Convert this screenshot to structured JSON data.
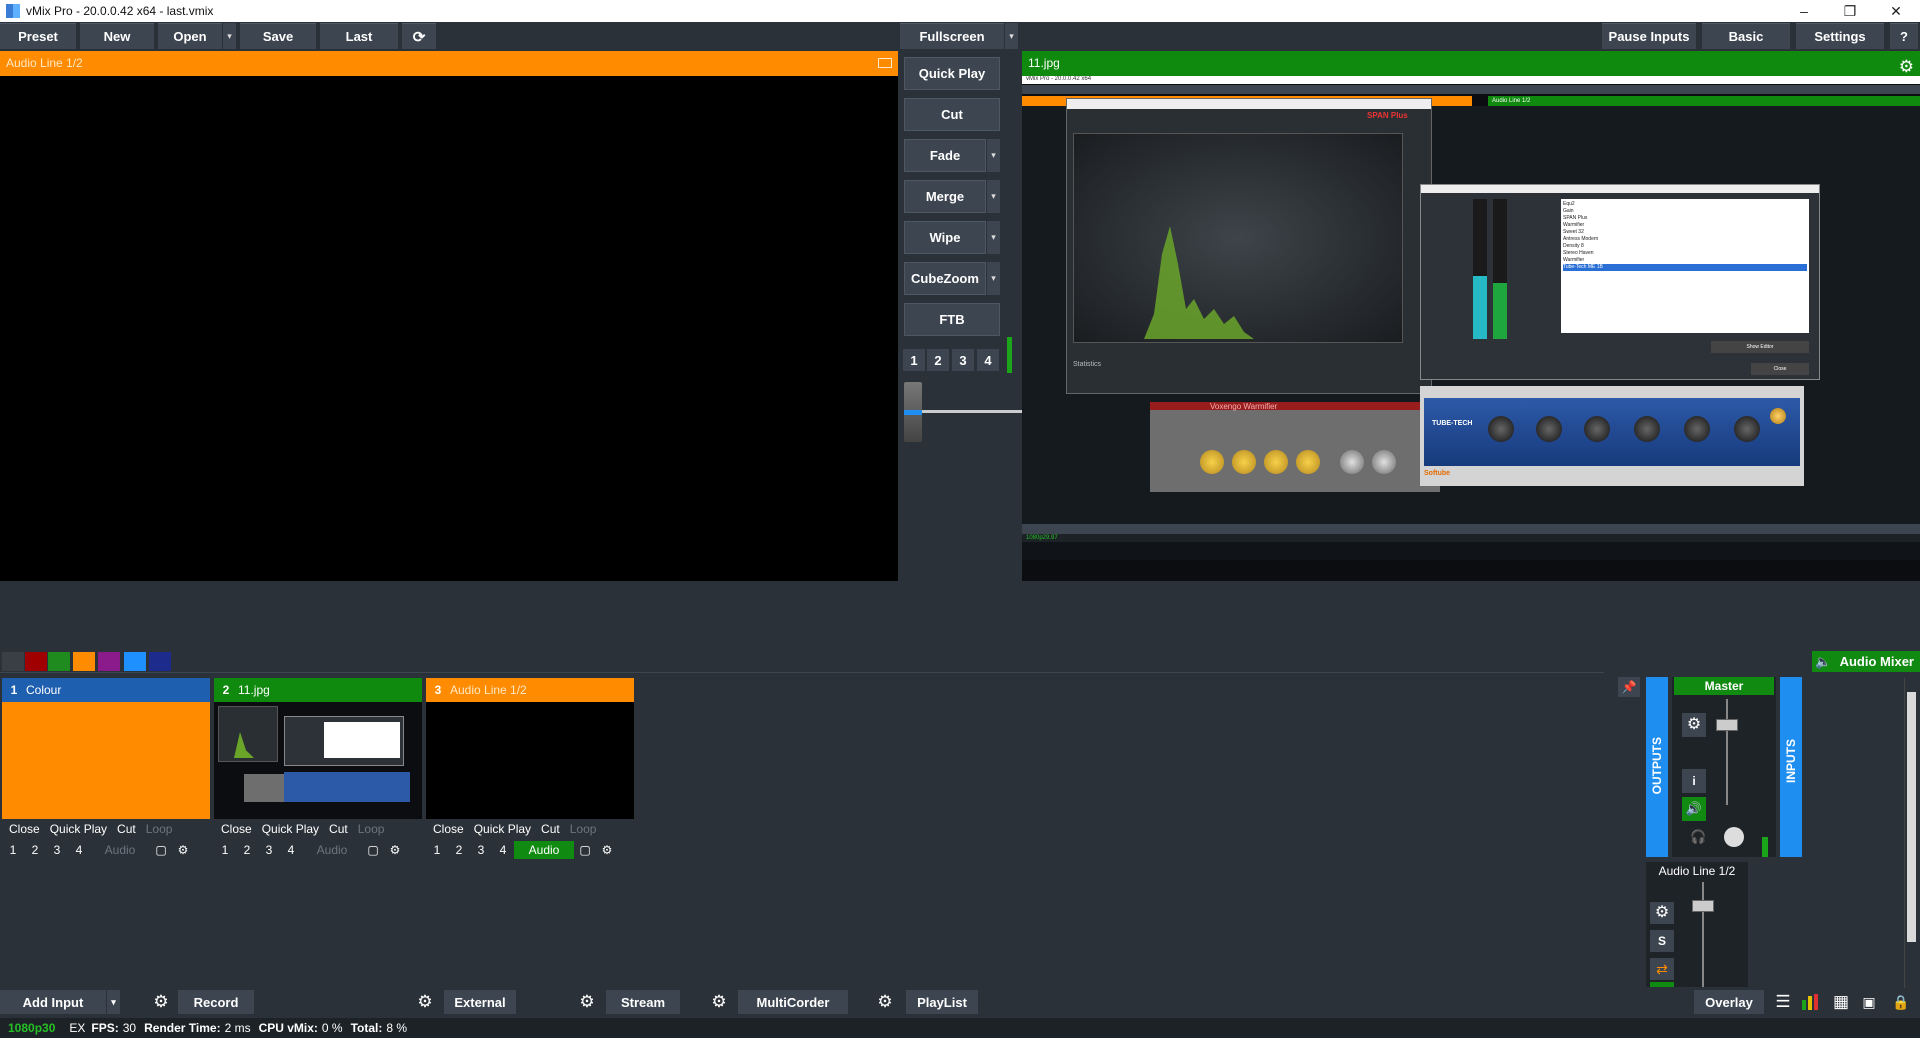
{
  "window": {
    "title": "vMix Pro - 20.0.0.42 x64 - last.vmix"
  },
  "toolbar": {
    "preset": "Preset",
    "new": "New",
    "open": "Open",
    "save": "Save",
    "last": "Last",
    "fullscreen": "Fullscreen",
    "pause_inputs": "Pause Inputs",
    "basic": "Basic",
    "settings": "Settings",
    "help": "?"
  },
  "preview": {
    "title": "Audio Line 1/2"
  },
  "output": {
    "title": "11.jpg"
  },
  "transitions": {
    "quick_play": "Quick Play",
    "cut": "Cut",
    "fade": "Fade",
    "merge": "Merge",
    "wipe": "Wipe",
    "cubezoom": "CubeZoom",
    "ftb": "FTB",
    "numbers": [
      "1",
      "2",
      "3",
      "4"
    ]
  },
  "colors": {
    "preview": "#ff8c00",
    "program": "#108a10",
    "accent": "#1f8ef1",
    "swatches": [
      "#3a3f46",
      "#a00000",
      "#1f8b1f",
      "#ff8c00",
      "#8b1a8b",
      "#1e90ff",
      "#1c2b8c"
    ]
  },
  "inputs": [
    {
      "num": "1",
      "name": "Colour",
      "head_color": "#1e5fb0",
      "controls": [
        "Close",
        "Quick Play",
        "Cut",
        "Loop"
      ],
      "audio": "Audio",
      "audio_on": false,
      "numbers": [
        "1",
        "2",
        "3",
        "4"
      ]
    },
    {
      "num": "2",
      "name": "11.jpg",
      "head_color": "#0f8a0f",
      "controls": [
        "Close",
        "Quick Play",
        "Cut",
        "Loop"
      ],
      "audio": "Audio",
      "audio_on": false,
      "numbers": [
        "1",
        "2",
        "3",
        "4"
      ]
    },
    {
      "num": "3",
      "name": "Audio Line 1/2",
      "head_color": "#ff8c00",
      "controls": [
        "Close",
        "Quick Play",
        "Cut",
        "Loop"
      ],
      "audio": "Audio",
      "audio_on": true,
      "numbers": [
        "1",
        "2",
        "3",
        "4"
      ]
    }
  ],
  "audio_mixer": {
    "button": "Audio Mixer",
    "outputs": "OUTPUTS",
    "inputs": "INPUTS",
    "master": "Master",
    "channel": "Audio Line 1/2",
    "solo": "S",
    "info": "i"
  },
  "bottom": {
    "add_input": "Add Input",
    "record": "Record",
    "external": "External",
    "stream": "Stream",
    "multicorder": "MultiCorder",
    "playlist": "PlayList",
    "overlay": "Overlay"
  },
  "status": {
    "format": "1080p30",
    "ex": "EX",
    "fps_label": "FPS:",
    "fps": "30",
    "render_label": "Render Time:",
    "render": "2 ms",
    "cpu_label": "CPU vMix:",
    "cpu": "0 %",
    "total_label": "Total:",
    "total": "8 %"
  },
  "nested": {
    "title": "vMix Pro - 20.0.0.42 x64",
    "span": "SPAN Plus",
    "statistics": "Statistics",
    "voxengo": "Voxengo Warmifier",
    "tubetech": "TUBE-TECH",
    "softube": "Softube",
    "show_editor": "Show Editor",
    "close": "Close",
    "plugins": [
      "Equ2",
      "Gain",
      "SPAN Plus",
      "Warmifier",
      "Sweet 32",
      "Antress Modern",
      "Density 8",
      "Stereo Haven",
      "Warmifier",
      "Tube-Tech ME 1B"
    ],
    "audio_line": "Audio Line 1/2",
    "format": "1080p29.97"
  }
}
